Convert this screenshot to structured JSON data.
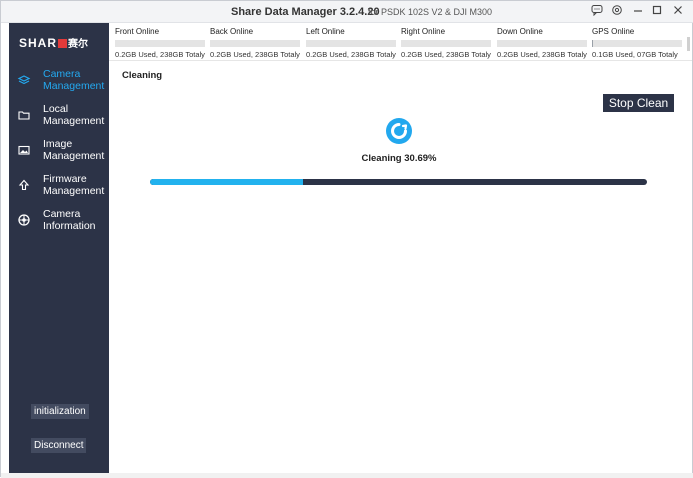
{
  "window": {
    "title": "Share Data Manager 3.2.4.20",
    "subtitle": "for PSDK 102S V2 & DJI M300"
  },
  "titlebar_icons": [
    "feedback-icon",
    "settings-icon",
    "minimize-icon",
    "maximize-icon",
    "close-icon"
  ],
  "sidebar": {
    "logo_text": "SHAR",
    "logo_cn": "赛尔",
    "items": [
      {
        "label": "Camera Management",
        "icon": "layers-icon",
        "active": true
      },
      {
        "label": "Local Management",
        "icon": "folder-icon",
        "active": false
      },
      {
        "label": "Image Management",
        "icon": "image-icon",
        "active": false
      },
      {
        "label": "Firmware Management",
        "icon": "upload-arrow-icon",
        "active": false
      },
      {
        "label": "Camera Information",
        "icon": "camera-lens-icon",
        "active": false
      }
    ],
    "init_label": "initialization",
    "disconnect_label": "Disconnect"
  },
  "storage": [
    {
      "label": "Front  Online",
      "usage": "0.2GB Used, 238GB Totaly",
      "used_fraction": 0.0
    },
    {
      "label": "Back  Online",
      "usage": "0.2GB Used, 238GB Totaly",
      "used_fraction": 0.0
    },
    {
      "label": "Left  Online",
      "usage": "0.2GB Used, 238GB Totaly",
      "used_fraction": 0.0
    },
    {
      "label": "Right  Online",
      "usage": "0.2GB Used, 238GB Totaly",
      "used_fraction": 0.0
    },
    {
      "label": "Down  Online",
      "usage": "0.2GB Used, 238GB Totaly",
      "used_fraction": 0.0
    },
    {
      "label": "GPS  Online",
      "usage": "0.1GB Used, 07GB Totaly",
      "used_fraction": 0.01
    }
  ],
  "main": {
    "section_title": "Cleaning",
    "stop_label": "Stop Clean",
    "progress_text": "Cleaning 30.69%",
    "progress_fraction": 0.3069
  },
  "colors": {
    "sidebar_bg": "#2c3347",
    "accent": "#24a9f0",
    "progress_fill": "#22b2ee"
  }
}
